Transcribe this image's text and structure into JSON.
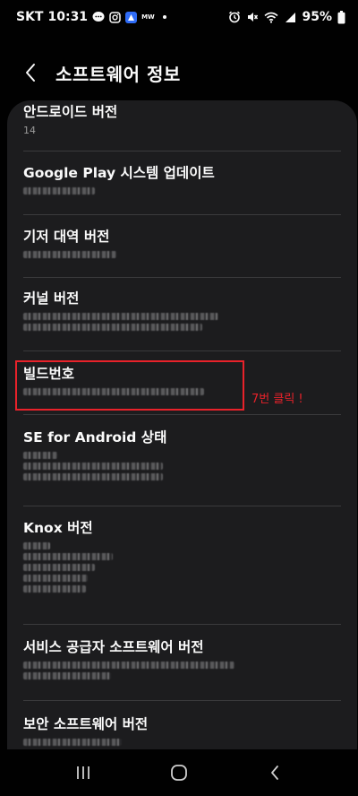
{
  "status_bar": {
    "carrier": "SKT",
    "time": "10:31",
    "battery": "95%",
    "mw_label": "MW",
    "left_icons": [
      "message-icon",
      "instagram-icon",
      "blue-app-icon",
      "mw-app-icon",
      "dot-icon"
    ],
    "right_icons": [
      "alarm-icon",
      "mute-icon",
      "wifi-icon",
      "signal-icon",
      "battery-icon"
    ]
  },
  "header": {
    "title": "소프트웨어 정보"
  },
  "items": [
    {
      "title": "안드로이드 버전",
      "value": "14"
    },
    {
      "title": "Google Play 시스템 업데이트",
      "value": ""
    },
    {
      "title": "기저 대역 버전",
      "value": ""
    },
    {
      "title": "커널 버전",
      "value": ""
    },
    {
      "title": "빌드번호",
      "value": ""
    },
    {
      "title": "SE for Android 상태",
      "value": ""
    },
    {
      "title": "Knox 버전",
      "value": ""
    },
    {
      "title": "서비스 공급자 소프트웨어 버전",
      "value": ""
    },
    {
      "title": "보안 소프트웨어 버전",
      "value": ""
    }
  ],
  "annotation": {
    "text": "7번 클릭 !",
    "color": "#e8222a"
  },
  "colors": {
    "background": "#010101",
    "card": "#1c1c1e",
    "text": "#fafafa",
    "secondary_text": "#9a9a9a"
  },
  "nav": {
    "buttons": [
      "recents-icon",
      "home-icon",
      "back-icon"
    ]
  }
}
